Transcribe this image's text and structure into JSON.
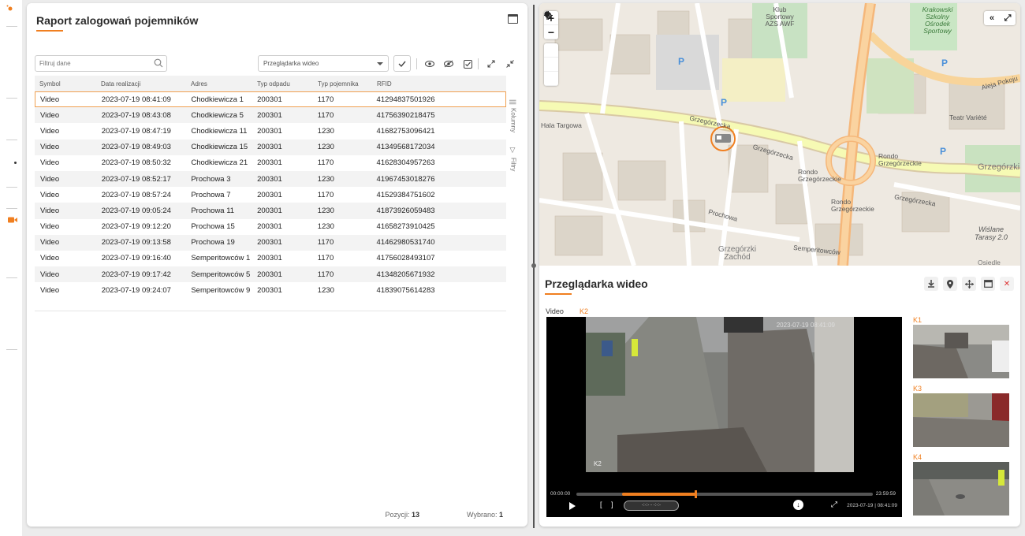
{
  "rail": {
    "icons": [
      "logo-icon",
      "camera-icon"
    ]
  },
  "left_panel": {
    "title": "Raport zalogowań pojemników",
    "filter_placeholder": "Filtruj dane",
    "video_select_value": "Przeglądarka wideo",
    "side_tabs": {
      "columns": "Kolumny",
      "filters": "Filtry"
    },
    "table": {
      "headers": [
        "Symbol",
        "Data realizacji",
        "Adres",
        "Typ odpadu",
        "Typ pojemnika",
        "RFID"
      ],
      "rows": [
        [
          "Video",
          "2023-07-19 08:41:09",
          "Chodkiewicza 1",
          "200301",
          "1170",
          "41294837501926"
        ],
        [
          "Video",
          "2023-07-19 08:43:08",
          "Chodkiewicza 5",
          "200301",
          "1170",
          "41756390218475"
        ],
        [
          "Video",
          "2023-07-19 08:47:19",
          "Chodkiewicza 11",
          "200301",
          "1230",
          "41682753096421"
        ],
        [
          "Video",
          "2023-07-19 08:49:03",
          "Chodkiewicza 15",
          "200301",
          "1230",
          "41349568172034"
        ],
        [
          "Video",
          "2023-07-19 08:50:32",
          "Chodkiewicza 21",
          "200301",
          "1170",
          "41628304957263"
        ],
        [
          "Video",
          "2023-07-19 08:52:17",
          "Prochowa 3",
          "200301",
          "1230",
          "41967453018276"
        ],
        [
          "Video",
          "2023-07-19 08:57:24",
          "Prochowa 7",
          "200301",
          "1170",
          "41529384751602"
        ],
        [
          "Video",
          "2023-07-19 09:05:24",
          "Prochowa 11",
          "200301",
          "1230",
          "41873926059483"
        ],
        [
          "Video",
          "2023-07-19 09:12:20",
          "Prochowa 15",
          "200301",
          "1230",
          "41658273910425"
        ],
        [
          "Video",
          "2023-07-19 09:13:58",
          "Prochowa 19",
          "200301",
          "1170",
          "41462980531740"
        ],
        [
          "Video",
          "2023-07-19 09:16:40",
          "Semperitowców 1",
          "200301",
          "1170",
          "41756028493107"
        ],
        [
          "Video",
          "2023-07-19 09:17:42",
          "Semperitowców 5",
          "200301",
          "1170",
          "41348205671932"
        ],
        [
          "Video",
          "2023-07-19 09:24:07",
          "Semperitowców 9",
          "200301",
          "1230",
          "41839075614283"
        ]
      ],
      "selected_row": 0
    },
    "footer": {
      "positions_label": "Pozycji:",
      "positions_value": "13",
      "selected_label": "Wybrano:",
      "selected_value": "1"
    }
  },
  "map": {
    "labels": {
      "street_grzegorzecka_1": "Grzegórzecka",
      "street_grzegorzecka_2": "Grzegórzecka",
      "street_grzegorzecka_3": "Grzegórzecka",
      "rondo_1": "Rondo Grzegórzeckie",
      "rondo_2": "Rondo Grzegórzeckie",
      "rondo_3": "Rondo Grzegórzeckie",
      "prochowa": "Prochowa",
      "semperitowcow": "Semperitowców",
      "klub": "Klub Sportowy AZS AWF",
      "krakowski": "Krakowski Szkolny Ośrodek Sportowy",
      "teatr": "Teatr Variété",
      "wislane": "Wiślane Tarasy 2.0",
      "grzegorzki_zachod": "Grzegórzki Zachód",
      "grzegorzki": "Grzegórzki",
      "aleja_pokoju": "Aleja Pokoju",
      "hala_targowa": "Hala Targowa",
      "osiedle": "Osiedle"
    }
  },
  "video_viewer": {
    "title": "Przeglądarka wideo",
    "video_label": "Video",
    "active_camera": "K2",
    "frame_timestamp": "2023-07-19 08:41:09",
    "frame_camera_label": "K2",
    "time_start": "00:00:00",
    "time_end": "23:59:59",
    "range_text": "-:-:- - -:-:-",
    "current_time": "2023-07-19 | 08:41:09",
    "progress_fraction_start": 0.155,
    "progress_fraction_end": 0.405,
    "thumbnails": [
      "K1",
      "K3",
      "K4"
    ],
    "accent_color": "#f07f20"
  }
}
